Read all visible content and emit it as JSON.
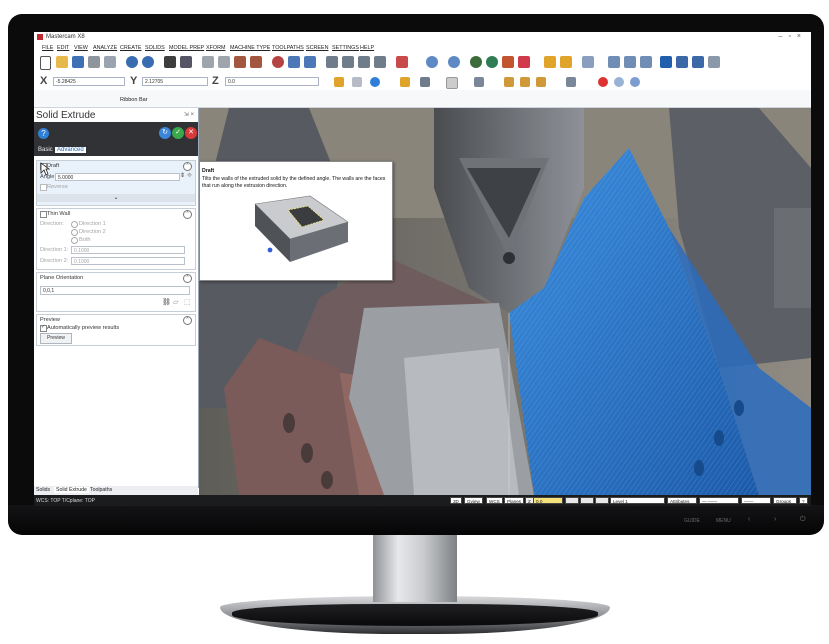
{
  "app": {
    "title": "Mastercam X8"
  },
  "menu": [
    "FILE",
    "EDIT",
    "VIEW",
    "ANALYZE",
    "CREATE",
    "SOLIDS",
    "MODEL PREP",
    "XFORM",
    "MACHINE TYPE",
    "TOOLPATHS",
    "SCREEN",
    "SETTINGS",
    "HELP"
  ],
  "coords": {
    "x_label": "X",
    "x_value": "-5.28425",
    "y_label": "Y",
    "y_value": "2.12705",
    "z_label": "Z",
    "z_value": "0.0"
  },
  "ribbon": {
    "label": "Ribbon Bar"
  },
  "panel": {
    "title": "Solid Extrude",
    "pin_glyph": "⇲ ×",
    "help_glyph": "?",
    "tabs": {
      "basic": "Basic",
      "advanced": "Advanced"
    },
    "draft": {
      "label": "Draft",
      "angle_label": "Angle",
      "angle_value": "5.0000",
      "reverse_label": "Reverse",
      "expand_glyph": "⌄"
    },
    "thin_wall": {
      "label": "Thin Wall",
      "direction_label": "Direction:",
      "options": [
        "Direction 1",
        "Direction 2",
        "Both"
      ],
      "dir1_label": "Direction 1:",
      "dir1_value": "0.1000",
      "dir2_label": "Direction 2:",
      "dir2_value": "0.1000"
    },
    "plane": {
      "label": "Plane Orientation",
      "value": "0,0,1"
    },
    "preview": {
      "label": "Preview",
      "auto_label": "Automatically preview results",
      "button": "Preview"
    },
    "bottom_tabs": [
      "Solids",
      "Solid Extrude",
      "Toolpaths"
    ]
  },
  "tooltip": {
    "title": "Draft",
    "text": "Tilts the walls of the extruded solid by the defined angle. The walls are the faces that run along the extrusion direction."
  },
  "status": {
    "left": "WCS: TOP  T/Cplane: TOP",
    "items": [
      "3D",
      "Gview",
      "WCS",
      "Planes",
      "Z",
      "0.0"
    ],
    "level_label": "Level",
    "level_value": "1",
    "attributes": "Attributes",
    "groups": "Groups",
    "help": "?"
  },
  "bezel": {
    "labels": [
      "GUIDE",
      "MENU"
    ]
  },
  "colors": {
    "accent": "#2f7fd8",
    "status_bg": "#1b1c1e",
    "panel_dark": "#303235",
    "toolpath_blue": "#2f7fd8",
    "stock_red": "#9a6a6a"
  }
}
